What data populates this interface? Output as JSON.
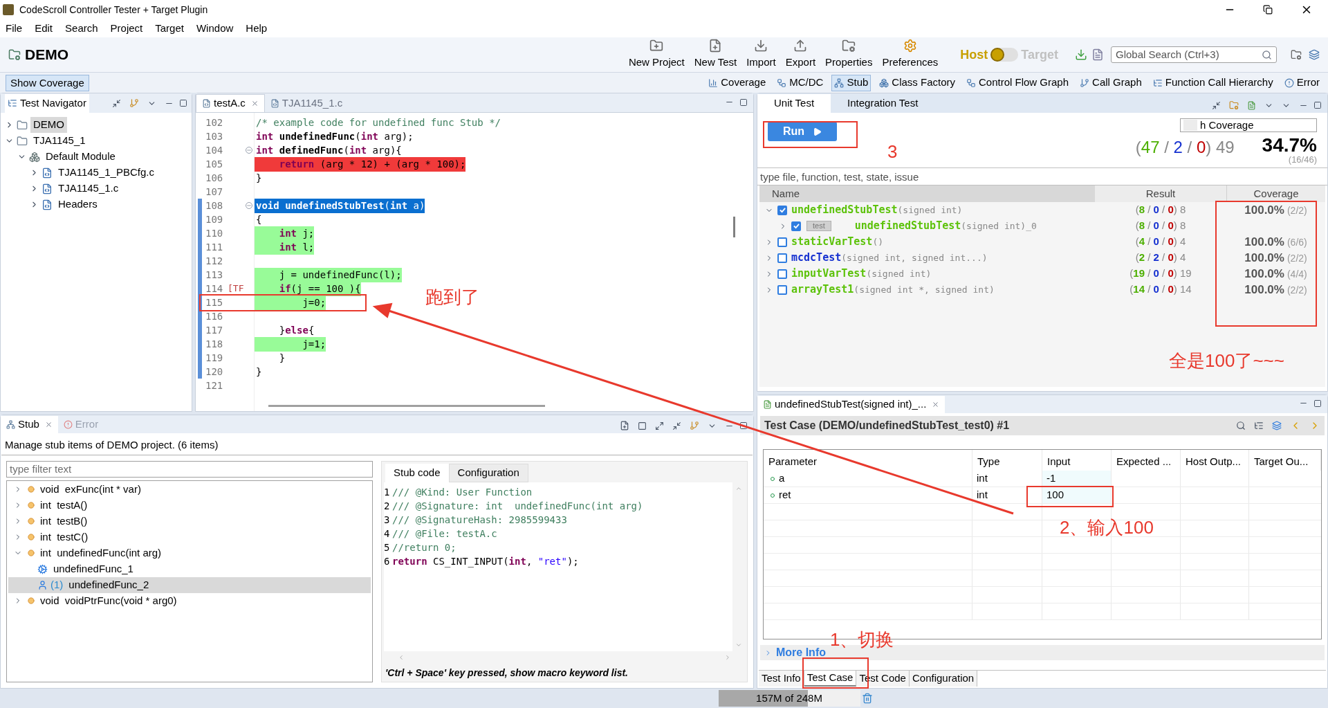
{
  "window": {
    "title": "CodeScroll Controller Tester + Target Plugin"
  },
  "menu": [
    "File",
    "Edit",
    "Search",
    "Project",
    "Target",
    "Window",
    "Help"
  ],
  "toolbar": {
    "project": "DEMO",
    "buttons": [
      "New Project",
      "New Test",
      "Import",
      "Export",
      "Properties",
      "Preferences"
    ],
    "mode": {
      "host": "Host",
      "target": "Target",
      "target_on": false
    },
    "search": {
      "placeholder": "Global Search (Ctrl+3)"
    }
  },
  "viewbar": {
    "show_coverage": {
      "label": "Show Coverage",
      "selected": true
    },
    "views": [
      {
        "label": "Coverage",
        "selected": false
      },
      {
        "label": "MC/DC",
        "selected": false
      },
      {
        "label": "Stub",
        "selected": true
      },
      {
        "label": "Class Factory",
        "selected": false
      },
      {
        "label": "Control Flow Graph",
        "selected": false
      },
      {
        "label": "Call Graph",
        "selected": false
      },
      {
        "label": "Function Call Hierarchy",
        "selected": false
      },
      {
        "label": "Error",
        "selected": false
      }
    ]
  },
  "navigator": {
    "title": "Test Navigator",
    "tree": [
      {
        "label": "DEMO",
        "selected": true,
        "expanded": false
      },
      {
        "label": "TJA1145_1",
        "selected": false,
        "expanded": true,
        "children": [
          {
            "label": "Default Module",
            "selected": false,
            "expanded": true,
            "children": [
              {
                "label": "TJA1145_1_PBCfg.c",
                "selected": false,
                "expanded": false
              },
              {
                "label": "TJA1145_1.c",
                "selected": false,
                "expanded": false
              },
              {
                "label": "Headers",
                "selected": false,
                "expanded": false
              }
            ]
          }
        ]
      }
    ]
  },
  "editor": {
    "tabs": [
      {
        "label": "testA.c",
        "selected": true
      },
      {
        "label": "TJA1145_1.c",
        "selected": false
      }
    ],
    "lines": [
      {
        "no": "102",
        "fold": false,
        "covered": false,
        "kind": "plain",
        "tokens": [
          {
            "t": "/* example code for undefined func Stub */",
            "kind": "comment"
          }
        ]
      },
      {
        "no": "103",
        "fold": false,
        "covered": false,
        "kind": "plain",
        "tokens": [
          {
            "t": "int",
            "kind": "kw"
          },
          {
            "t": " undefinedFunc",
            "kind": "fn"
          },
          {
            "t": "(",
            "kind": "text"
          },
          {
            "t": "int",
            "kind": "kw"
          },
          {
            "t": " arg);",
            "kind": "text"
          }
        ]
      },
      {
        "no": "104",
        "fold": true,
        "covered": false,
        "kind": "plain",
        "tokens": [
          {
            "t": "int",
            "kind": "kw"
          },
          {
            "t": " definedFunc",
            "kind": "fn"
          },
          {
            "t": "(",
            "kind": "text"
          },
          {
            "t": "int",
            "kind": "kw"
          },
          {
            "t": " arg){",
            "kind": "text"
          }
        ]
      },
      {
        "no": "105",
        "fold": false,
        "covered": false,
        "kind": "missed",
        "tokens": [
          {
            "t": "    return",
            "kind": "kw"
          },
          {
            "t": " (arg * 12) + (arg * 100);",
            "kind": "text"
          }
        ]
      },
      {
        "no": "106",
        "fold": false,
        "covered": false,
        "kind": "plain",
        "tokens": [
          {
            "t": "}",
            "kind": "text"
          }
        ]
      },
      {
        "no": "107",
        "fold": false,
        "covered": false
      },
      {
        "no": "108",
        "fold": true,
        "covered": true,
        "kind": "selected",
        "tokens": [
          {
            "t": "void",
            "kind": "kw"
          },
          {
            "t": " undefinedStubTest",
            "kind": "fn"
          },
          {
            "t": "(",
            "kind": "text"
          },
          {
            "t": "int",
            "kind": "kw"
          },
          {
            "t": " a)",
            "kind": "text"
          }
        ]
      },
      {
        "no": "109",
        "fold": false,
        "covered": true,
        "kind": "plain",
        "tokens": [
          {
            "t": "{",
            "kind": "text"
          }
        ]
      },
      {
        "no": "110",
        "fold": false,
        "covered": true,
        "kind": "executed",
        "tokens": [
          {
            "t": "    int",
            "kind": "kw"
          },
          {
            "t": " j;",
            "kind": "text"
          }
        ]
      },
      {
        "no": "111",
        "fold": false,
        "covered": true,
        "kind": "executed",
        "tokens": [
          {
            "t": "    int",
            "kind": "kw"
          },
          {
            "t": " l;",
            "kind": "text"
          }
        ]
      },
      {
        "no": "112",
        "fold": false,
        "covered": true
      },
      {
        "no": "113",
        "fold": false,
        "covered": true,
        "kind": "executed",
        "tokens": [
          {
            "t": "    j = undefinedFunc(l);",
            "kind": "text"
          }
        ]
      },
      {
        "no": "114",
        "marker": "[TF",
        "fold": false,
        "covered": true,
        "kind": "executed",
        "tokens": [
          {
            "t": "    if",
            "kind": "kw"
          },
          {
            "t": "(j == 100 ){",
            "kind": "text"
          }
        ]
      },
      {
        "no": "115",
        "fold": false,
        "covered": true,
        "kind": "executed",
        "tokens": [
          {
            "t": "        j=0;",
            "kind": "text"
          }
        ]
      },
      {
        "no": "116",
        "fold": false,
        "covered": true
      },
      {
        "no": "117",
        "fold": false,
        "covered": true,
        "kind": "plain",
        "tokens": [
          {
            "t": "    }",
            "kind": "text"
          },
          {
            "t": "else",
            "kind": "kw"
          },
          {
            "t": "{",
            "kind": "text"
          }
        ]
      },
      {
        "no": "118",
        "fold": false,
        "covered": true,
        "kind": "executed",
        "tokens": [
          {
            "t": "        j=1;",
            "kind": "text"
          }
        ]
      },
      {
        "no": "119",
        "fold": false,
        "covered": true,
        "kind": "plain",
        "tokens": [
          {
            "t": "    }",
            "kind": "text"
          }
        ]
      },
      {
        "no": "120",
        "fold": false,
        "covered": true,
        "kind": "plain",
        "tokens": [
          {
            "t": "}",
            "kind": "text"
          }
        ]
      },
      {
        "no": "121",
        "fold": false,
        "covered": false
      }
    ]
  },
  "stub": {
    "tabs": [
      {
        "label": "Stub",
        "selected": true
      },
      {
        "label": "Error",
        "selected": false
      }
    ],
    "description": "Manage stub items of DEMO project. (6 items)",
    "filter": {
      "placeholder": "type filter text"
    },
    "tree": [
      {
        "kind": "function",
        "label": "void  exFunc(int * var)",
        "expanded": false,
        "selected": false
      },
      {
        "kind": "function",
        "label": "int  testA()",
        "expanded": false,
        "selected": false
      },
      {
        "kind": "function",
        "label": "int  testB()",
        "expanded": false,
        "selected": false
      },
      {
        "kind": "function",
        "label": "int  testC()",
        "expanded": false,
        "selected": false
      },
      {
        "kind": "function",
        "label": "int  undefinedFunc(int arg)",
        "expanded": true,
        "selected": false,
        "children": [
          {
            "kind": "generated",
            "label": "undefinedFunc_1",
            "selected": false
          },
          {
            "kind": "user",
            "count": "(1)",
            "label": "undefinedFunc_2",
            "selected": true
          }
        ]
      },
      {
        "kind": "function",
        "label": "void  voidPtrFunc(void * arg0)",
        "expanded": false,
        "selected": false
      }
    ],
    "code_tabs": [
      {
        "label": "Stub code",
        "selected": true
      },
      {
        "label": "Configuration",
        "selected": false
      }
    ],
    "code": [
      {
        "no": "1",
        "tokens": [
          {
            "t": "/// @Kind: User Function",
            "kind": "comment"
          }
        ]
      },
      {
        "no": "2",
        "tokens": [
          {
            "t": "/// @Signature: int  undefinedFunc(int arg)",
            "kind": "comment"
          }
        ]
      },
      {
        "no": "3",
        "tokens": [
          {
            "t": "/// @SignatureHash: 2985599433",
            "kind": "comment"
          }
        ]
      },
      {
        "no": "4",
        "tokens": [
          {
            "t": "/// @File: testA.c",
            "kind": "comment"
          }
        ]
      },
      {
        "no": "5",
        "tokens": [
          {
            "t": "//return 0;",
            "kind": "comment"
          }
        ]
      },
      {
        "no": "6",
        "tokens": [
          {
            "t": "return",
            "kind": "kw"
          },
          {
            "t": " CS_INT_INPUT(",
            "kind": "text"
          },
          {
            "t": "int",
            "kind": "kw"
          },
          {
            "t": ", ",
            "kind": "text"
          },
          {
            "t": "\"ret\"",
            "kind": "string"
          },
          {
            "t": ");",
            "kind": "text"
          }
        ]
      }
    ],
    "hint": "'Ctrl + Space' key pressed, show macro keyword list."
  },
  "unit_test": {
    "tabs": [
      {
        "label": "Unit Test",
        "selected": true
      },
      {
        "label": "Integration Test",
        "selected": false
      }
    ],
    "run": "Run",
    "coverage_type": "h Coverage",
    "summary": {
      "result": [
        {
          "t": "(",
          "kind": "sep"
        },
        {
          "t": "47",
          "kind": "passed"
        },
        {
          "t": " / ",
          "kind": "sep"
        },
        {
          "t": "2",
          "kind": "failed"
        },
        {
          "t": " / ",
          "kind": "sep"
        },
        {
          "t": "0",
          "kind": "error"
        },
        {
          "t": ") 49",
          "kind": "sep"
        }
      ],
      "coverage": "34.7%",
      "fraction": "(16/46)"
    },
    "filter": {
      "placeholder": "type file, function, test, state, issue"
    },
    "columns": [
      "Name",
      "Result",
      "Coverage"
    ],
    "rows": [
      {
        "name": "undefinedStubTest",
        "signature": "(signed int)",
        "has_failures": false,
        "checked": true,
        "expanded": true,
        "result": [
          {
            "t": "(",
            "kind": "sep"
          },
          {
            "t": "8",
            "kind": "passed"
          },
          {
            "t": " / ",
            "kind": "sep"
          },
          {
            "t": "0",
            "kind": "failed"
          },
          {
            "t": " / ",
            "kind": "sep"
          },
          {
            "t": "0",
            "kind": "error"
          },
          {
            "t": ") 8",
            "kind": "sep"
          }
        ],
        "coverage": "100.0%",
        "fraction": "(2/2)",
        "children": [
          {
            "badge": "test",
            "name": "undefinedStubTest",
            "signature": "(signed int)_0",
            "has_failures": false,
            "checked": true,
            "expanded": false,
            "result": [
              {
                "t": "(",
                "kind": "sep"
              },
              {
                "t": "8",
                "kind": "passed"
              },
              {
                "t": " / ",
                "kind": "sep"
              },
              {
                "t": "0",
                "kind": "failed"
              },
              {
                "t": " / ",
                "kind": "sep"
              },
              {
                "t": "0",
                "kind": "error"
              },
              {
                "t": ") 8",
                "kind": "sep"
              }
            ]
          }
        ]
      },
      {
        "name": "staticVarTest",
        "signature": "()",
        "has_failures": false,
        "checked": false,
        "expanded": false,
        "result": [
          {
            "t": "(",
            "kind": "sep"
          },
          {
            "t": "4",
            "kind": "passed"
          },
          {
            "t": " / ",
            "kind": "sep"
          },
          {
            "t": "0",
            "kind": "failed"
          },
          {
            "t": " / ",
            "kind": "sep"
          },
          {
            "t": "0",
            "kind": "error"
          },
          {
            "t": ") 4",
            "kind": "sep"
          }
        ],
        "coverage": "100.0%",
        "fraction": "(6/6)"
      },
      {
        "name": "mcdcTest",
        "signature": "(signed int, signed int...)",
        "has_failures": true,
        "checked": false,
        "expanded": false,
        "result": [
          {
            "t": "(",
            "kind": "sep"
          },
          {
            "t": "2",
            "kind": "passed"
          },
          {
            "t": " / ",
            "kind": "sep"
          },
          {
            "t": "2",
            "kind": "failed"
          },
          {
            "t": " / ",
            "kind": "sep"
          },
          {
            "t": "0",
            "kind": "error"
          },
          {
            "t": ") 4",
            "kind": "sep"
          }
        ],
        "coverage": "100.0%",
        "fraction": "(2/2)"
      },
      {
        "name": "inputVarTest",
        "signature": "(signed int)",
        "has_failures": false,
        "checked": false,
        "expanded": false,
        "result": [
          {
            "t": "(",
            "kind": "sep"
          },
          {
            "t": "19",
            "kind": "passed"
          },
          {
            "t": " / ",
            "kind": "sep"
          },
          {
            "t": "0",
            "kind": "failed"
          },
          {
            "t": " / ",
            "kind": "sep"
          },
          {
            "t": "0",
            "kind": "error"
          },
          {
            "t": ") 19",
            "kind": "sep"
          }
        ],
        "coverage": "100.0%",
        "fraction": "(4/4)"
      },
      {
        "name": "arrayTest1",
        "signature": "(signed int *, signed int)",
        "has_failures": false,
        "checked": false,
        "expanded": false,
        "result": [
          {
            "t": "(",
            "kind": "sep"
          },
          {
            "t": "14",
            "kind": "passed"
          },
          {
            "t": " / ",
            "kind": "sep"
          },
          {
            "t": "0",
            "kind": "failed"
          },
          {
            "t": " / ",
            "kind": "sep"
          },
          {
            "t": "0",
            "kind": "error"
          },
          {
            "t": ") 14",
            "kind": "sep"
          }
        ],
        "coverage": "100.0%",
        "fraction": "(2/2)"
      }
    ]
  },
  "test_case": {
    "tab": "undefinedStubTest(signed int)_...",
    "title": "Test Case (DEMO/undefinedStubTest_test0) #1",
    "columns": [
      "Parameter",
      "Type",
      "Input",
      "Expected ...",
      "Host Outp...",
      "Target Ou..."
    ],
    "rows": [
      {
        "parameter": "a",
        "type": "int",
        "input": "-1"
      },
      {
        "parameter": "ret",
        "type": "int",
        "input": "100"
      }
    ],
    "more_info": {
      "label": "More Info",
      "expanded": false
    },
    "bottom_tabs": [
      {
        "label": "Test Info",
        "selected": false
      },
      {
        "label": "Test Case",
        "selected": true
      },
      {
        "label": "Test Code",
        "selected": false
      },
      {
        "label": "Configuration",
        "selected": false
      }
    ]
  },
  "status_bar": {
    "memory": "157M of 248M",
    "level": 0.633
  },
  "notes": [
    "跑到了",
    "3",
    "全是100了~~~",
    "2、输入100",
    "1、切换"
  ]
}
